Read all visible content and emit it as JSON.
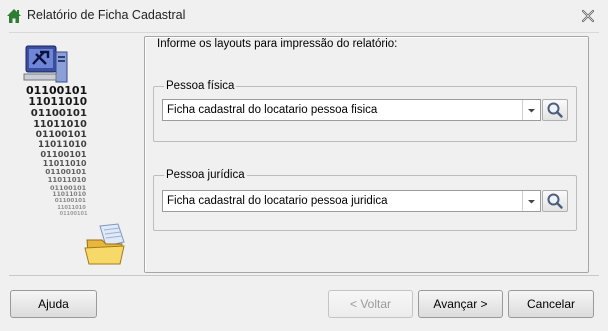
{
  "window": {
    "title": "Relatório de Ficha Cadastral"
  },
  "panel": {
    "legend": "Informe os layouts para impressão do relatório:"
  },
  "pessoa_fisica": {
    "label": "Pessoa física",
    "value": "Ficha cadastral do locatario pessoa fisica"
  },
  "pessoa_juridica": {
    "label": "Pessoa jurídica",
    "value": "Ficha cadastral do locatario pessoa juridica"
  },
  "art": {
    "binary_lines": [
      "01100101",
      "11011010",
      "01100101",
      "11011010",
      "01100101",
      "11011010",
      "01100101",
      "11011010",
      "01100101",
      "11011010",
      "01100101",
      "11011010",
      "01100101",
      "11011010",
      "01100101"
    ]
  },
  "buttons": {
    "help": "Ajuda",
    "back": "< Voltar",
    "next": "Avançar >",
    "cancel": "Cancelar"
  },
  "icons": {
    "window": "home-icon",
    "close": "close-icon",
    "dropdown": "chevron-down-icon",
    "search": "search-icon",
    "computer": "computer-icon",
    "folder": "open-folder-icon"
  }
}
